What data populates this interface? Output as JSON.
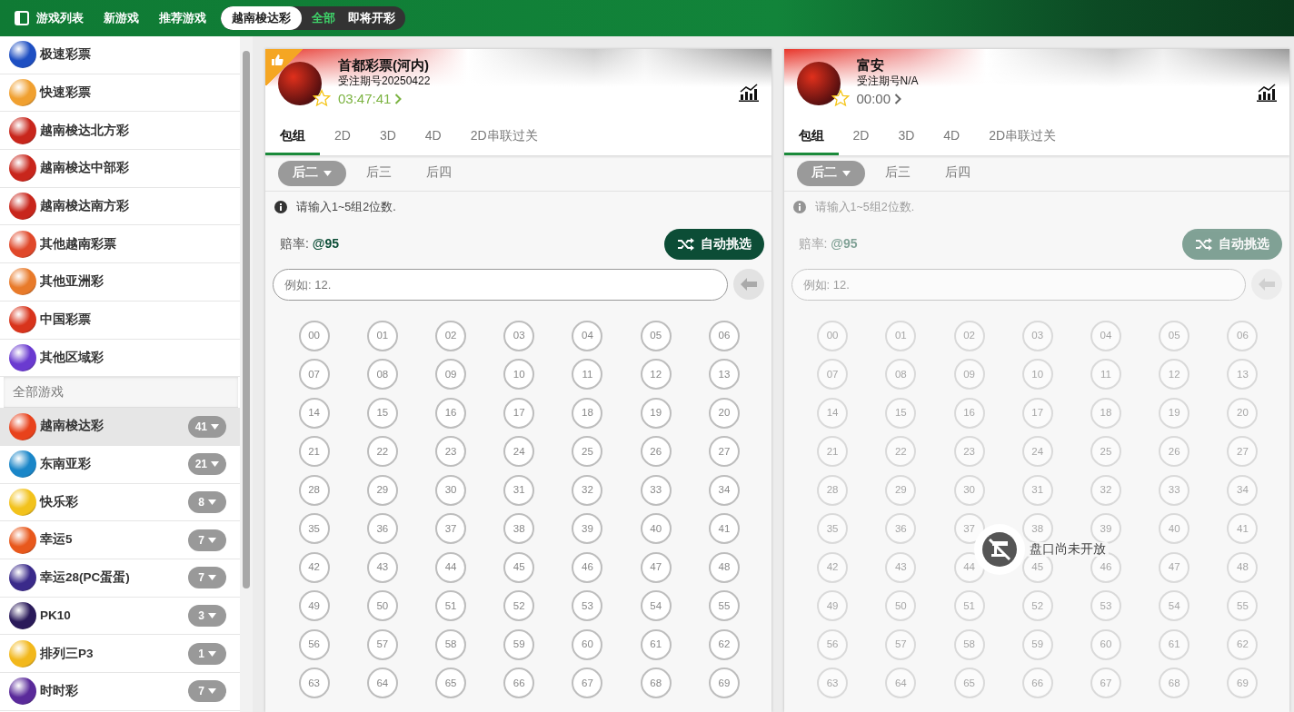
{
  "top_nav": {
    "items": [
      {
        "label": "游戏列表",
        "kind": "toggle"
      },
      {
        "label": "新游戏",
        "kind": "link"
      },
      {
        "label": "推荐游戏",
        "kind": "link"
      }
    ],
    "region": {
      "label": "越南梭达彩",
      "selected": true
    },
    "filters": [
      {
        "label": "全部",
        "selected": true
      },
      {
        "label": "即将开彩",
        "selected": false
      }
    ]
  },
  "sidebar": {
    "categories": [
      {
        "name": "极速彩票",
        "color": "#1e4fc2"
      },
      {
        "name": "快速彩票",
        "color": "#f0a030"
      },
      {
        "name": "越南梭达北方彩",
        "color": "#c8261c"
      },
      {
        "name": "越南梭达中部彩",
        "color": "#c8261c"
      },
      {
        "name": "越南梭达南方彩",
        "color": "#c8261c"
      },
      {
        "name": "其他越南彩票",
        "color": "#e0482a"
      },
      {
        "name": "其他亚洲彩",
        "color": "#e87a2a"
      },
      {
        "name": "中国彩票",
        "color": "#d8341c"
      },
      {
        "name": "其他区域彩",
        "color": "#6a3ad0"
      }
    ],
    "section_title": "全部游戏",
    "games": [
      {
        "name": "越南梭达彩",
        "count": "41",
        "selected": true,
        "color": "#e8421c"
      },
      {
        "name": "东南亚彩",
        "count": "21",
        "selected": false,
        "color": "#1a86c8"
      },
      {
        "name": "快乐彩",
        "count": "8",
        "selected": false,
        "color": "#f2c21c"
      },
      {
        "name": "幸运5",
        "count": "7",
        "selected": false,
        "color": "#e8581c"
      },
      {
        "name": "幸运28(PC蛋蛋)",
        "count": "7",
        "selected": false,
        "color": "#3a2a8a"
      },
      {
        "name": "PK10",
        "count": "3",
        "selected": false,
        "color": "#2a1a5a"
      },
      {
        "name": "排列三P3",
        "count": "1",
        "selected": false,
        "color": "#f2b81c"
      },
      {
        "name": "时时彩",
        "count": "7",
        "selected": false,
        "color": "#5a2a9a"
      }
    ]
  },
  "panels": [
    {
      "title": "首都彩票(河内)",
      "issue": "受注期号20250422",
      "timer": "03:47:41",
      "hot": true,
      "favorite": false,
      "disabled": false,
      "tabs": [
        {
          "label": "包组",
          "selected": true
        },
        {
          "label": "2D",
          "selected": false
        },
        {
          "label": "3D",
          "selected": false
        },
        {
          "label": "4D",
          "selected": false
        },
        {
          "label": "2D串联过关",
          "selected": false
        }
      ],
      "subtabs": [
        {
          "label": "后二",
          "selected": true
        },
        {
          "label": "后三",
          "selected": false
        },
        {
          "label": "后四",
          "selected": false
        }
      ],
      "hint": "请输入1~5组2位数.",
      "odds_label": "赔率:",
      "odds": "@95",
      "auto_button": "自动挑选",
      "placeholder": "例如: 12.",
      "numbers": [
        "00",
        "01",
        "02",
        "03",
        "04",
        "05",
        "06",
        "07",
        "08",
        "09",
        "10",
        "11",
        "12",
        "13",
        "14",
        "15",
        "16",
        "17",
        "18",
        "19",
        "20",
        "21",
        "22",
        "23",
        "24",
        "25",
        "26",
        "27",
        "28",
        "29",
        "30",
        "31",
        "32",
        "33",
        "34",
        "35",
        "36",
        "37",
        "38",
        "39",
        "40",
        "41",
        "42",
        "43",
        "44",
        "45",
        "46",
        "47",
        "48",
        "49",
        "50",
        "51",
        "52",
        "53",
        "54",
        "55",
        "56",
        "57",
        "58",
        "59",
        "60",
        "61",
        "62",
        "63",
        "64",
        "65",
        "66",
        "67",
        "68",
        "69"
      ]
    },
    {
      "title": "富安",
      "issue": "受注期号N/A",
      "timer": "00:00",
      "hot": false,
      "favorite": false,
      "disabled": true,
      "tabs": [
        {
          "label": "包组",
          "selected": true
        },
        {
          "label": "2D",
          "selected": false
        },
        {
          "label": "3D",
          "selected": false
        },
        {
          "label": "4D",
          "selected": false
        },
        {
          "label": "2D串联过关",
          "selected": false
        }
      ],
      "subtabs": [
        {
          "label": "后二",
          "selected": true
        },
        {
          "label": "后三",
          "selected": false
        },
        {
          "label": "后四",
          "selected": false
        }
      ],
      "hint": "请输入1~5组2位数.",
      "odds_label": "赔率:",
      "odds": "@95",
      "auto_button": "自动挑选",
      "placeholder": "例如: 12.",
      "numbers": [
        "00",
        "01",
        "02",
        "03",
        "04",
        "05",
        "06",
        "07",
        "08",
        "09",
        "10",
        "11",
        "12",
        "13",
        "14",
        "15",
        "16",
        "17",
        "18",
        "19",
        "20",
        "21",
        "22",
        "23",
        "24",
        "25",
        "26",
        "27",
        "28",
        "29",
        "30",
        "31",
        "32",
        "33",
        "34",
        "35",
        "36",
        "37",
        "38",
        "39",
        "40",
        "41",
        "42",
        "43",
        "44",
        "45",
        "46",
        "47",
        "48",
        "49",
        "50",
        "51",
        "52",
        "53",
        "54",
        "55",
        "56",
        "57",
        "58",
        "59",
        "60",
        "61",
        "62",
        "63",
        "64",
        "65",
        "66",
        "67",
        "68",
        "69"
      ],
      "closed_message": "盘口尚未开放"
    }
  ]
}
